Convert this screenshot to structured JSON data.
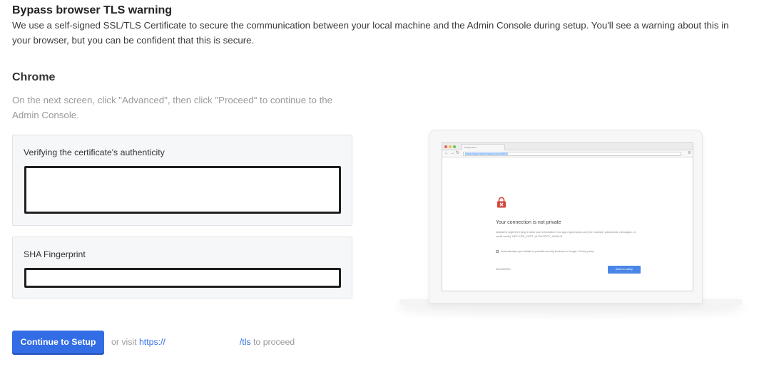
{
  "page": {
    "title": "Bypass browser TLS warning",
    "intro": "We use a self-signed SSL/TLS Certificate to secure the communication between your local machine and the Admin Console during setup. You'll see a warning about this in your browser, but you can be confident that this is secure."
  },
  "chrome": {
    "heading": "Chrome",
    "description": "On the next screen, click \"Advanced\", then click \"Proceed\" to continue to the Admin Console."
  },
  "certificate": {
    "label": "Verifying the certificate's authenticity",
    "value": ""
  },
  "fingerprint": {
    "label": "SHA Fingerprint",
    "value": ""
  },
  "actions": {
    "continue_label": "Continue to Setup",
    "visit_prefix": "or visit",
    "link_start": "https://",
    "link_end": "/tls",
    "visit_suffix": "to proceed"
  },
  "illustration": {
    "tab_title": "Privacy error",
    "url": "https://app.mycompany.com:8800",
    "error_title": "Your connection is not private",
    "error_text": "Attackers might be trying to steal your information from app.mycompany.com (for example, passwords, messages, or credit cards). NET::ERR_CERT_AUTHORITY_INVALID",
    "checkbox_text": "Automatically report details of possible security incidents to Google. Privacy policy",
    "advanced_label": "ADVANCED",
    "back_label": "Back to safety"
  },
  "colors": {
    "accent": "#326de6",
    "error_red": "#d2463c",
    "muted_text": "#9a9a9a",
    "panel_bg": "#f5f7f9"
  }
}
